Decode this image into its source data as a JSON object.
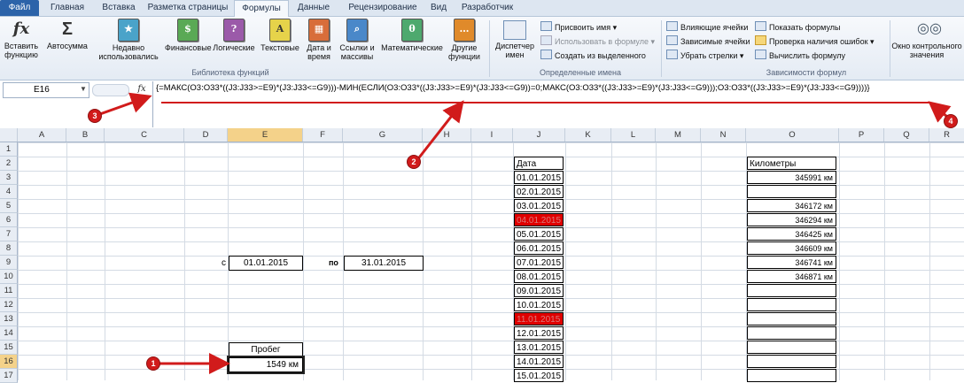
{
  "tabs": [
    "Файл",
    "Главная",
    "Вставка",
    "Разметка страницы",
    "Формулы",
    "Данные",
    "Рецензирование",
    "Вид",
    "Разработчик"
  ],
  "ribbon": {
    "insert_function": "Вставить функцию",
    "autosum": "Автосумма",
    "recent": "Недавно использовались",
    "financial": "Финансовые",
    "logical": "Логические",
    "text": "Текстовые",
    "datetime": "Дата и время",
    "lookup": "Ссылки и массивы",
    "math": "Математические",
    "other": "Другие функции",
    "library_label": "Библиотека функций",
    "name_manager": "Диспетчер имен",
    "assign_name": "Присвоить имя",
    "use_in_formula": "Использовать в формуле",
    "create_from_selection": "Создать из выделенного",
    "names_label": "Определенные имена",
    "trace_precedents": "Влияющие ячейки",
    "trace_dependents": "Зависимые ячейки",
    "remove_arrows": "Убрать стрелки",
    "show_formulas": "Показать формулы",
    "error_check": "Проверка наличия ошибок",
    "evaluate_formula": "Вычислить формулу",
    "audit_label": "Зависимости формул",
    "watch_window": "Окно контрольного значения"
  },
  "formula_bar": {
    "name_box": "E16",
    "fx": "fx",
    "formula": "{=МАКС(O3:O33*((J3:J33>=E9)*(J3:J33<=G9)))-МИН(ЕСЛИ(O3:O33*((J3:J33>=E9)*(J3:J33<=G9))=0;МАКС(O3:O33*((J3:J33>=E9)*(J3:J33<=G9)));O3:O33*((J3:J33>=E9)*(J3:J33<=G9))))}"
  },
  "columns": [
    "A",
    "B",
    "C",
    "D",
    "E",
    "F",
    "G",
    "H",
    "I",
    "J",
    "K",
    "L",
    "M",
    "N",
    "O",
    "P",
    "Q",
    "R"
  ],
  "rows": [
    "1",
    "2",
    "3",
    "4",
    "5",
    "6",
    "7",
    "8",
    "9",
    "10",
    "11",
    "12",
    "13",
    "14",
    "15",
    "16",
    "17"
  ],
  "cells": {
    "c_label": "с",
    "start_date": "01.01.2015",
    "po_label": "по",
    "end_date": "31.01.2015",
    "probeg_header": "Пробег",
    "probeg_value": "1549 км",
    "date_header": "Дата",
    "km_header": "Километры"
  },
  "dates": [
    "01.01.2015",
    "02.01.2015",
    "03.01.2015",
    "04.01.2015",
    "05.01.2015",
    "06.01.2015",
    "07.01.2015",
    "08.01.2015",
    "09.01.2015",
    "10.01.2015",
    "11.01.2015",
    "12.01.2015",
    "13.01.2015",
    "14.01.2015",
    "15.01.2015"
  ],
  "km": [
    "345991 км",
    "",
    "346172 км",
    "346294 км",
    "346425 км",
    "346609 км",
    "346741 км",
    "346871 км",
    "",
    "",
    "",
    "",
    "",
    "",
    ""
  ],
  "red_dates": [
    "04.01.2015",
    "11.01.2015"
  ],
  "annotations": [
    "1",
    "2",
    "3",
    "4"
  ],
  "colors": {
    "accent": "#2c63a9",
    "highlight": "#e00000",
    "annotation": "#d11b1b"
  }
}
